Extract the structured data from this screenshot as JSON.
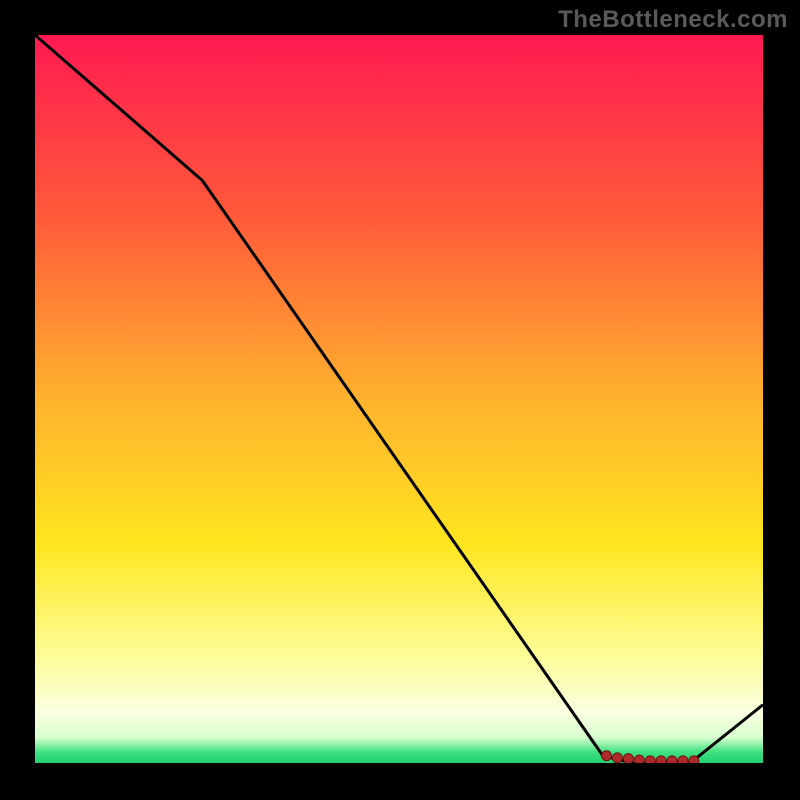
{
  "watermark": "TheBottleneck.com",
  "chart_data": {
    "type": "line",
    "title": "",
    "xlabel": "",
    "ylabel": "",
    "xlim": [
      0,
      100
    ],
    "ylim": [
      0,
      100
    ],
    "x": [
      0,
      23,
      78,
      82,
      90,
      100
    ],
    "y": [
      100,
      80,
      1,
      0,
      0,
      8
    ],
    "markers": {
      "x": [
        78.5,
        80,
        81.5,
        83,
        84.5,
        86,
        87.5,
        89,
        90.5
      ],
      "y": [
        1.0,
        0.7,
        0.6,
        0.4,
        0.3,
        0.3,
        0.3,
        0.3,
        0.3
      ]
    },
    "gradient_stops": [
      {
        "offset": 0.0,
        "color": "#ff1a52"
      },
      {
        "offset": 0.25,
        "color": "#ff5a3a"
      },
      {
        "offset": 0.5,
        "color": "#ffb22e"
      },
      {
        "offset": 0.7,
        "color": "#ffe61f"
      },
      {
        "offset": 0.85,
        "color": "#fdfd96"
      },
      {
        "offset": 0.93,
        "color": "#fbffe0"
      },
      {
        "offset": 0.965,
        "color": "#d8ffd0"
      },
      {
        "offset": 0.985,
        "color": "#40e080"
      },
      {
        "offset": 1.0,
        "color": "#20d070"
      }
    ],
    "line_color": "#000000",
    "marker_fill": "#b02a2a",
    "marker_stroke": "#6e1414"
  }
}
